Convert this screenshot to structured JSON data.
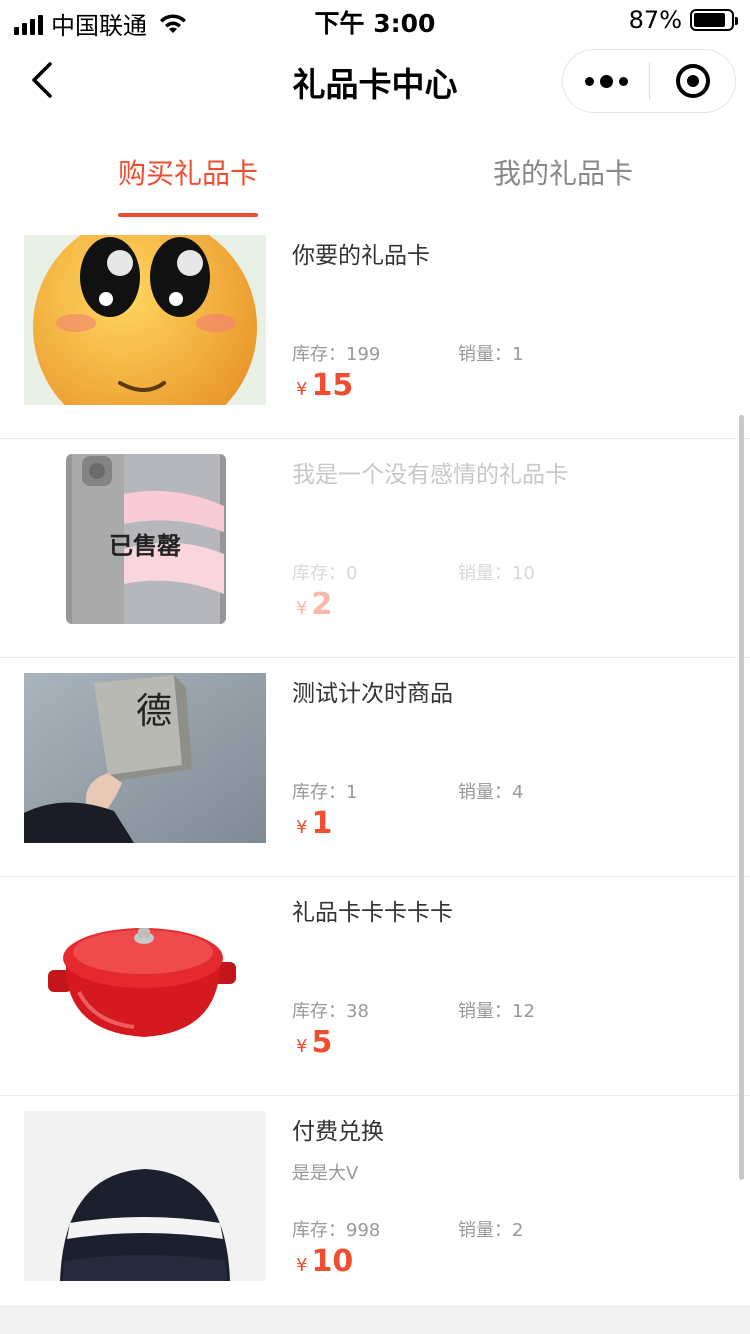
{
  "status": {
    "carrier": "中国联通",
    "time": "下午 3:00",
    "battery": "87%",
    "battery_level": 0.87
  },
  "nav": {
    "title": "礼品卡中心"
  },
  "tabs": [
    {
      "label": "购买礼品卡",
      "active": true
    },
    {
      "label": "我的礼品卡",
      "active": false
    }
  ],
  "labels": {
    "stock_prefix": "库存：",
    "sold_prefix": "销量：",
    "currency": "¥",
    "soldout": "已售罄"
  },
  "items": [
    {
      "name": "你要的礼品卡",
      "subtitle": "",
      "stock": "199",
      "sold": "1",
      "price": "15",
      "image": "smiling-emoji",
      "sold_out": false
    },
    {
      "name": "我是一个没有感情的礼品卡",
      "subtitle": "",
      "stock": "0",
      "sold": "10",
      "price": "2",
      "image": "phone",
      "sold_out": true
    },
    {
      "name": "测试计次时商品",
      "subtitle": "",
      "stock": "1",
      "sold": "4",
      "price": "1",
      "image": "hand-holding-brick",
      "brick_text": "德",
      "sold_out": false
    },
    {
      "name": "礼品卡卡卡卡卡",
      "subtitle": "",
      "stock": "38",
      "sold": "12",
      "price": "5",
      "image": "red-pot",
      "sold_out": false
    },
    {
      "name": "付费兑换",
      "subtitle": "是是大V",
      "stock": "998",
      "sold": "2",
      "price": "10",
      "image": "beanie-hat",
      "sold_out": false
    }
  ],
  "colors": {
    "accent": "#f04e2f",
    "text": "#333333",
    "muted": "#999999"
  }
}
